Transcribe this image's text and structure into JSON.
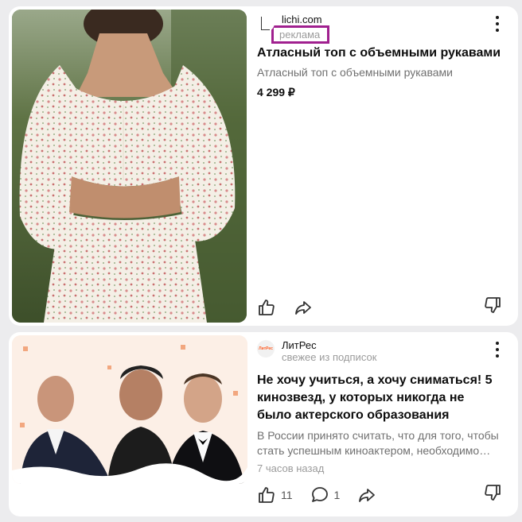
{
  "feed": {
    "card1": {
      "source_name": "lichi.com",
      "ad_label": "реклама",
      "title": "Атласный топ с объемными рукавами",
      "description": "Атласный топ с объемными рукавами",
      "price": "4 299 ₽",
      "image_icon": "product-photo-floral-top"
    },
    "card2": {
      "source_name": "ЛитРес",
      "source_logo_text": "ЛитРес",
      "subtitle": "свежее из подписок",
      "title": "Не хочу учиться, а хочу сниматься! 5 кинозвезд, у которых никогда не было актерского образования",
      "description": "В России принято считать, что для того, чтобы стать успешным киноактером, необходимо…",
      "time": "7 часов назад",
      "likes": "11",
      "comments": "1",
      "image_icon": "three-actors-photo"
    }
  },
  "colors": {
    "ad_highlight": "#a0208f",
    "background": "#ececee",
    "brand_litres": "#ff5a1f"
  }
}
